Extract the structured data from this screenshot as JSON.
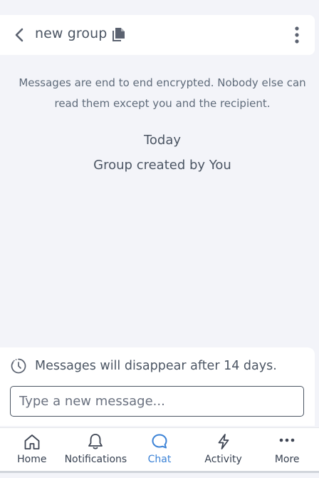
{
  "header": {
    "title": "new group",
    "back_icon": "chevron-left-icon",
    "copy_icon": "copy-icon",
    "menu_icon": "kebab-menu-icon"
  },
  "messages": {
    "encryption_notice": "Messages are end to end encrypted. Nobody else can read them except you and the recipient.",
    "day_separator": "Today",
    "system_message": "Group created by You"
  },
  "composer": {
    "disappear_notice": "Messages will disappear after 14 days.",
    "timer_icon": "timer-icon",
    "input_placeholder": "Type a new message...",
    "input_value": ""
  },
  "nav": {
    "active_color": "#3b82d6",
    "items": [
      {
        "label": "Home",
        "icon": "home-icon"
      },
      {
        "label": "Notifications",
        "icon": "bell-icon"
      },
      {
        "label": "Chat",
        "icon": "chat-icon",
        "active": true
      },
      {
        "label": "Activity",
        "icon": "lightning-icon"
      },
      {
        "label": "More",
        "icon": "more-dots-icon"
      }
    ]
  }
}
